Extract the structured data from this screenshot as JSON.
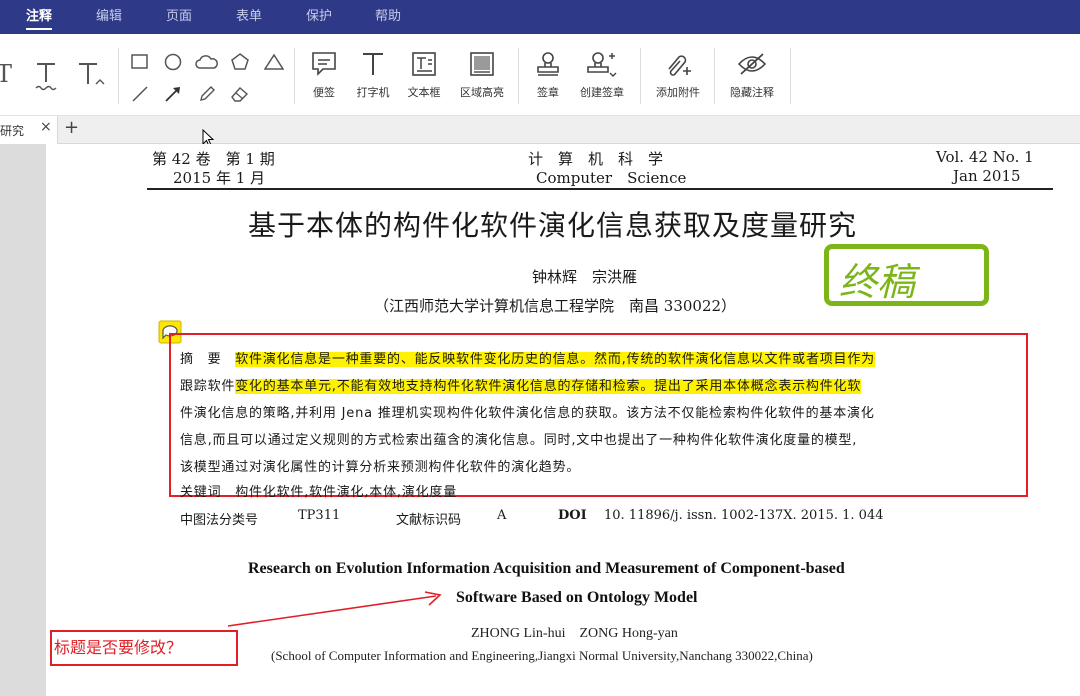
{
  "menu": [
    {
      "label": "注释",
      "active": true
    },
    {
      "label": "编辑",
      "active": false
    },
    {
      "label": "页面",
      "active": false
    },
    {
      "label": "表单",
      "active": false
    },
    {
      "label": "保护",
      "active": false
    },
    {
      "label": "帮助",
      "active": false
    }
  ],
  "toolbar": {
    "text_tools": [
      "text-strike-icon",
      "text-underline-wavy-icon",
      "text-insert-icon"
    ],
    "shape_tools": [
      "rectangle-icon",
      "ellipse-icon",
      "cloud-icon",
      "polygon-icon",
      "triangle-icon",
      "line-icon",
      "arrow-icon",
      "pencil-icon",
      "eraser-icon"
    ],
    "note_label": "便签",
    "typewriter_label": "打字机",
    "textbox_label": "文本框",
    "area_highlight_label": "区域高亮",
    "stamp_label": "签章",
    "create_stamp_label": "创建签章",
    "attach_label": "添加附件",
    "hide_annot_label": "隐藏注释"
  },
  "tab": {
    "label": "研究",
    "close": "×",
    "add": "+"
  },
  "document": {
    "header_left_1": "第 42 卷　第 1 期",
    "header_left_2": "2015 年 1 月",
    "journal_cn": "计　算　机　科　学",
    "journal_en": "Computer　Science",
    "header_right_1": "Vol. 42 No. 1",
    "header_right_2": "Jan 2015",
    "title_cn": "基于本体的构件化软件演化信息获取及度量研究",
    "authors_cn": "钟林辉　宗洪雁",
    "affiliation_cn": "（江西师范大学计算机信息工程学院　南昌 330022）",
    "stamp_text": "终稿",
    "abstract": {
      "label": "摘　要",
      "line1_hl": "软件演化信息是一种重要的、能反映软件变化历史的信息。然而,传统的软件演化信息以文件或者项目作为",
      "line2_pre": "跟踪软件",
      "line2_hl": "变化的基本单元,不能有效地支持构件化软件演化信息的存储和检索。提出了采用本体概念表示构件化软",
      "line3": "件演化信息的策略,并利用 Jena 推理机实现构件化软件演化信息的获取。该方法不仅能检索构件化软件的基本演化",
      "line4": "信息,而且可以通过定义规则的方式检索出蕴含的演化信息。同时,文中也提出了一种构件化软件演化度量的模型,",
      "line5": "该模型通过对演化属性的计算分析来预测构件化软件的演化趋势。",
      "keywords": "关键词　构件化软件,软件演化,本体,演化度量"
    },
    "clc_label": "中图法分类号",
    "clc_value": "TP311",
    "doccode_label": "文献标识码",
    "doccode_value": "A",
    "doi_label": "DOI",
    "doi_value": "10. 11896/j. issn. 1002-137X. 2015. 1. 044",
    "title_en_1": "Research on Evolution Information Acquisition and Measurement of Component-based",
    "title_en_2": "Software Based on Ontology Model",
    "authors_en": "ZHONG Lin-hui　ZONG Hong-yan",
    "affiliation_en": "(School of Computer Information and Engineering,Jiangxi Normal University,Nanchang 330022,China)"
  },
  "comment": {
    "text": "标题是否要修改？"
  },
  "colors": {
    "menubar": "#2e3a87",
    "highlight": "#fff200",
    "annotation_red": "#e01f26",
    "stamp_green": "#7cb518"
  }
}
